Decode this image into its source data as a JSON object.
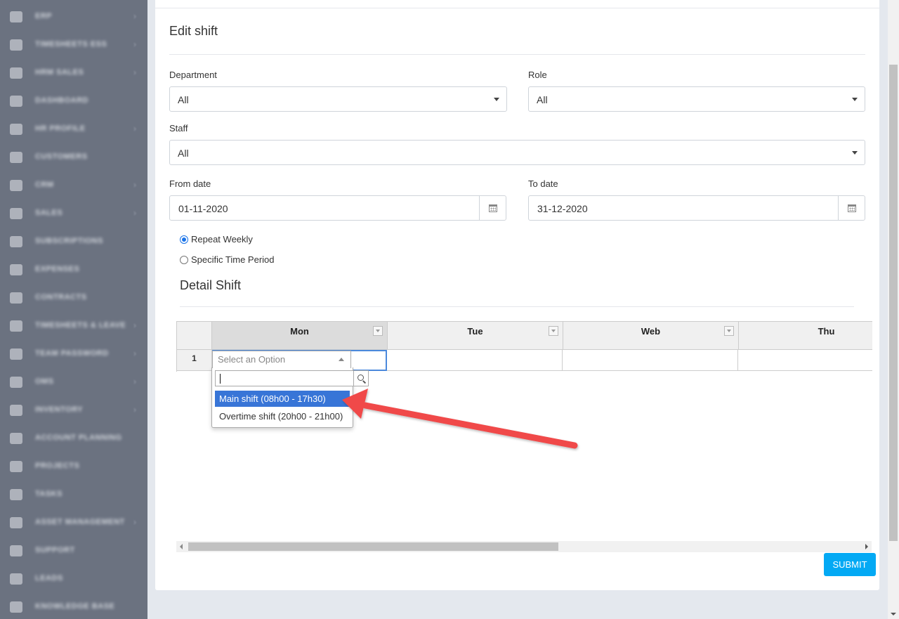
{
  "sidebar": {
    "items": [
      {
        "label": "ERP",
        "has_children": true
      },
      {
        "label": "Timesheets ESS",
        "has_children": true
      },
      {
        "label": "HRM Sales",
        "has_children": true
      },
      {
        "label": "Dashboard",
        "has_children": false
      },
      {
        "label": "HR Profile",
        "has_children": true
      },
      {
        "label": "Customers",
        "has_children": false
      },
      {
        "label": "CRM",
        "has_children": true
      },
      {
        "label": "Sales",
        "has_children": true
      },
      {
        "label": "Subscriptions",
        "has_children": false
      },
      {
        "label": "Expenses",
        "has_children": false
      },
      {
        "label": "Contracts",
        "has_children": false
      },
      {
        "label": "Timesheets & Leave",
        "has_children": true
      },
      {
        "label": "Team Password",
        "has_children": true
      },
      {
        "label": "OMS",
        "has_children": true
      },
      {
        "label": "Inventory",
        "has_children": true
      },
      {
        "label": "Account Planning",
        "has_children": false
      },
      {
        "label": "Projects",
        "has_children": false
      },
      {
        "label": "Tasks",
        "has_children": false
      },
      {
        "label": "Asset Management",
        "has_children": true
      },
      {
        "label": "Support",
        "has_children": false
      },
      {
        "label": "Leads",
        "has_children": false
      },
      {
        "label": "Knowledge Base",
        "has_children": false
      }
    ]
  },
  "form": {
    "title": "Edit shift",
    "department": {
      "label": "Department",
      "value": "All"
    },
    "role": {
      "label": "Role",
      "value": "All"
    },
    "staff": {
      "label": "Staff",
      "value": "All"
    },
    "from_date": {
      "label": "From date",
      "value": "01-11-2020"
    },
    "to_date": {
      "label": "To date",
      "value": "31-12-2020"
    },
    "repeat": {
      "options": [
        {
          "label": "Repeat Weekly",
          "checked": true
        },
        {
          "label": "Specific Time Period",
          "checked": false
        }
      ]
    }
  },
  "detail": {
    "title": "Detail Shift",
    "columns": [
      "Mon",
      "Tue",
      "Web",
      "Thu"
    ],
    "rows": [
      {
        "number": "1",
        "cells": [
          "",
          "",
          "",
          ""
        ]
      }
    ],
    "active_column": "Mon"
  },
  "dropdown": {
    "placeholder": "Select an Option",
    "search_value": "",
    "options": [
      {
        "label": "Main shift (08h00 - 17h30)",
        "highlighted": true
      },
      {
        "label": "Overtime shift (20h00 - 21h00)",
        "highlighted": false
      }
    ]
  },
  "actions": {
    "submit_label": "SUBMIT"
  },
  "colors": {
    "sidebar_bg": "#6b7280",
    "page_bg": "#e4e8ee",
    "highlight": "#3875d7",
    "submit": "#03a9f4",
    "annotation_arrow": "#f04a4a"
  }
}
